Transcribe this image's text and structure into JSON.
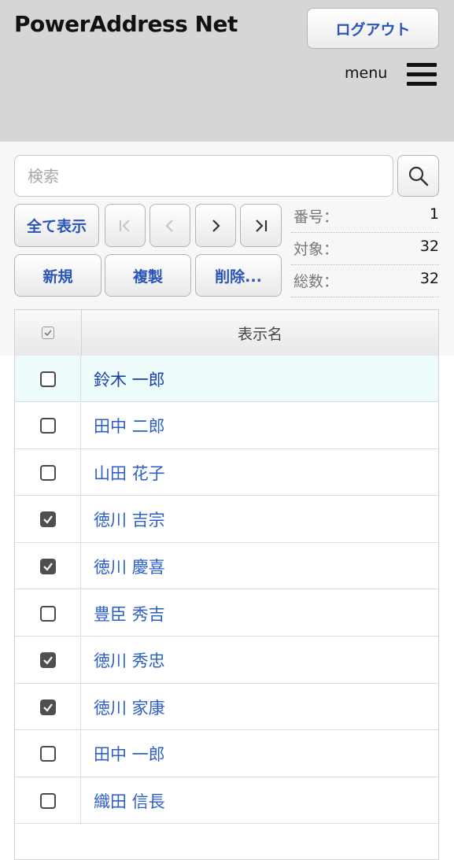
{
  "header": {
    "title": "PowerAddress Net",
    "logout_label": "ログアウト",
    "menu_label": "menu"
  },
  "search": {
    "placeholder": "検索",
    "value": ""
  },
  "toolbar": {
    "show_all_label": "全て表示",
    "first_label": "|<",
    "prev_label": "<",
    "next_label": ">",
    "last_label": ">|",
    "new_label": "新規",
    "duplicate_label": "複製",
    "delete_label": "削除..."
  },
  "info": {
    "number_label": "番号：",
    "number_value": "1",
    "target_label": "対象：",
    "target_value": "32",
    "total_label": "総数：",
    "total_value": "32"
  },
  "list": {
    "column_header": "表示名",
    "rows": [
      {
        "name": "鈴木 一郎",
        "checked": false,
        "selected": true
      },
      {
        "name": "田中 二郎",
        "checked": false,
        "selected": false
      },
      {
        "name": "山田 花子",
        "checked": false,
        "selected": false
      },
      {
        "name": "徳川 吉宗",
        "checked": true,
        "selected": false
      },
      {
        "name": "徳川 慶喜",
        "checked": true,
        "selected": false
      },
      {
        "name": "豊臣 秀吉",
        "checked": false,
        "selected": false
      },
      {
        "name": "徳川 秀忠",
        "checked": true,
        "selected": false
      },
      {
        "name": "徳川 家康",
        "checked": true,
        "selected": false
      },
      {
        "name": "田中 一郎",
        "checked": false,
        "selected": false
      },
      {
        "name": "織田 信長",
        "checked": false,
        "selected": false
      }
    ]
  },
  "colors": {
    "accent": "#2a55b8",
    "link": "#2c5ec8",
    "header_bg": "#d6d6d6",
    "selected_row_bg": "#eefbfb"
  }
}
